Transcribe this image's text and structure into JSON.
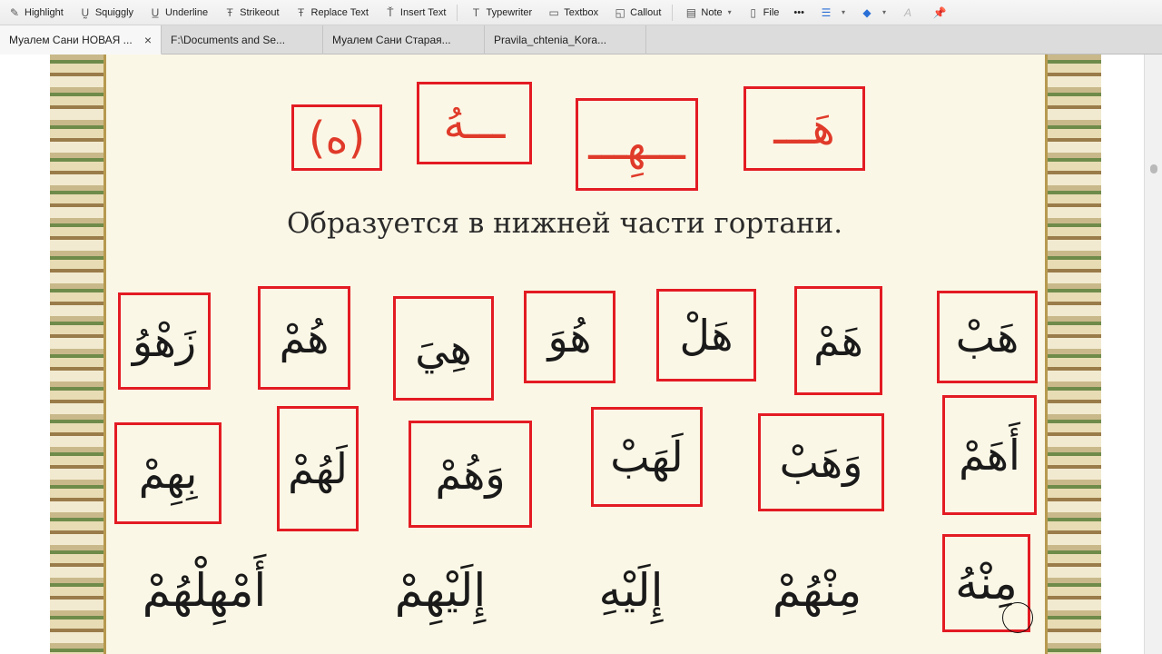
{
  "toolbar": {
    "highlight": "Highlight",
    "squiggly": "Squiggly",
    "underline": "Underline",
    "strikeout": "Strikeout",
    "replace_text": "Replace Text",
    "insert_text": "Insert Text",
    "typewriter": "Typewriter",
    "textbox": "Textbox",
    "callout": "Callout",
    "note": "Note",
    "file": "File",
    "more": "•••"
  },
  "tabs": [
    {
      "label": "Муалем Сани НОВАЯ ...",
      "close": "×"
    },
    {
      "label": "F:\\Documents and Se..."
    },
    {
      "label": "Муалем Сани Старая..."
    },
    {
      "label": "Pravila_chtenia_Kora..."
    }
  ],
  "page": {
    "letter_forms": [
      "(ه)",
      "ـــهُ",
      "ـــهِـــ",
      "هَـــ"
    ],
    "caption": "Образуется в нижней части гортани.",
    "row1": [
      "زَهْوُ",
      "هُمْ",
      "هِيَ",
      "هُوَ",
      "هَلْ",
      "هَمْ",
      "هَبْ"
    ],
    "row2": [
      "بِهِمْ",
      "لَهُمْ",
      "وَهُمْ",
      "لَهَبْ",
      "وَهَبْ",
      "أَهَمْ"
    ],
    "row3": [
      "أَمْهِلْهُمْ",
      "إِلَيْهِمْ",
      "إِلَيْهِ",
      "مِنْهُمْ",
      "مِنْهُ"
    ]
  },
  "colors": {
    "annotation_red": "#e31b23",
    "letter_red": "#e03a2a",
    "page_bg": "#fbf7e6"
  }
}
